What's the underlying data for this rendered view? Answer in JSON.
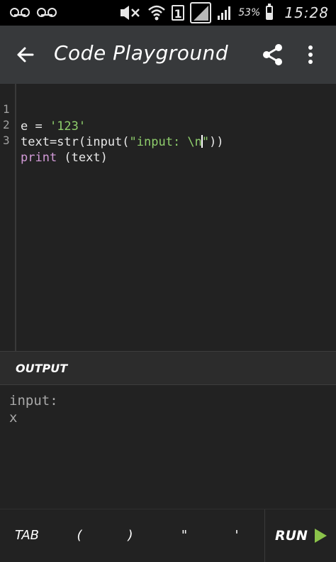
{
  "status_bar": {
    "battery_percent": "53%",
    "time": "15:28",
    "sim_slot": "1",
    "icons": [
      "voicemail-icon",
      "voicemail-icon",
      "mute-icon",
      "wifi-icon",
      "sim-icon",
      "signal-icon",
      "battery-icon"
    ]
  },
  "app_bar": {
    "title": "Code Playground",
    "back_icon": "arrow-back-icon",
    "share_icon": "share-icon",
    "more_icon": "more-vert-icon",
    "background": "#37393b"
  },
  "editor": {
    "line_numbers": [
      "1",
      "2",
      "3"
    ],
    "lines": [
      {
        "a": "e = ",
        "b": "'123'"
      },
      {
        "a": "text=str(input(",
        "b": "\"input: \\n",
        "c": "\"",
        "d": "))"
      },
      {
        "kw": "print",
        "rest": " (text)"
      }
    ]
  },
  "output": {
    "header": "OUTPUT",
    "lines": [
      "input:",
      "x"
    ]
  },
  "keys": {
    "tab": "TAB",
    "open_paren": "(",
    "close_paren": ")",
    "double_quote": "\"",
    "single_quote": "'",
    "run": "RUN",
    "run_icon": "play-icon",
    "run_color": "#8bc34a"
  }
}
